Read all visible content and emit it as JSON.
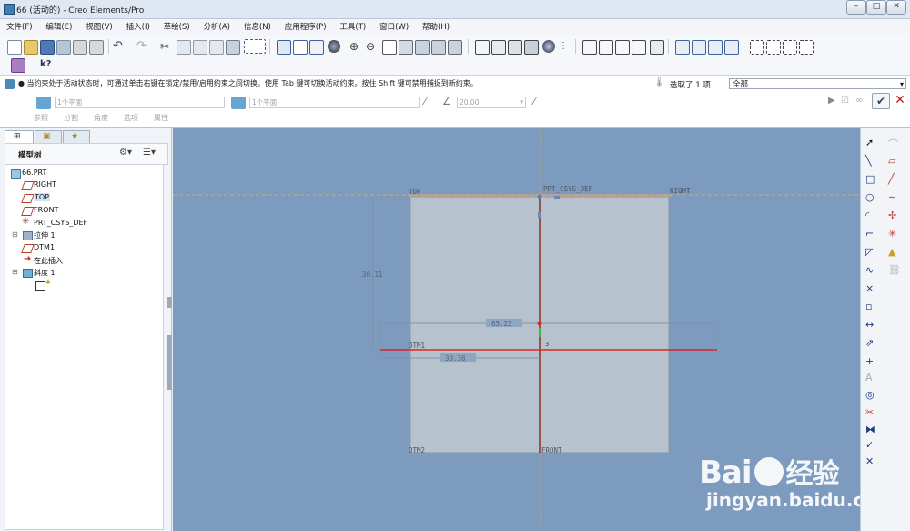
{
  "window": {
    "title": "66 (活动的) - Creo Elements/Pro"
  },
  "menu": [
    "文件(F)",
    "编辑(E)",
    "视图(V)",
    "插入(I)",
    "草绘(S)",
    "分析(A)",
    "信息(N)",
    "应用程序(P)",
    "工具(T)",
    "窗口(W)",
    "帮助(H)"
  ],
  "dashboard": {
    "message": "● 当约束处于活动状态时，可通过单击右键在锁定/禁用/启用约束之间切换。使用 Tab 键可切换活动约束。按住 Shift 键可禁用捕捉到新约束。",
    "selection": "选取了 1 项",
    "filter": "全部",
    "ref1_placeholder": "1个平面",
    "ref2_placeholder": "1个平面",
    "angle_value": "20.00",
    "tabs": [
      "参照",
      "分割",
      "角度",
      "选项",
      "属性"
    ]
  },
  "model_tree": {
    "title": "模型树",
    "items": [
      {
        "label": "66.PRT",
        "selected": false
      },
      {
        "label": "RIGHT",
        "selected": false
      },
      {
        "label": "TOP",
        "selected": true
      },
      {
        "label": "FRONT",
        "selected": false
      },
      {
        "label": "PRT_CSYS_DEF",
        "selected": false
      },
      {
        "label": "拉伸 1",
        "selected": false
      },
      {
        "label": "DTM1",
        "selected": false
      },
      {
        "label": "在此插入",
        "selected": false
      },
      {
        "label": "斜度 1",
        "selected": false
      }
    ]
  },
  "canvas": {
    "labels": {
      "top": "TOP",
      "csys": "PRT_CSYS_DEF",
      "right": "RIGHT",
      "dtm1": "DTM1",
      "dtm2": "DTM2",
      "front": "FRONT",
      "dim_vertical": "30.11",
      "dim_h1": "65.23",
      "dim_h2": "30.38",
      "marker": "3"
    }
  },
  "watermark": {
    "brand_latin": "Bai",
    "brand_cn": "经验",
    "url": "jingyan.baidu.com"
  }
}
